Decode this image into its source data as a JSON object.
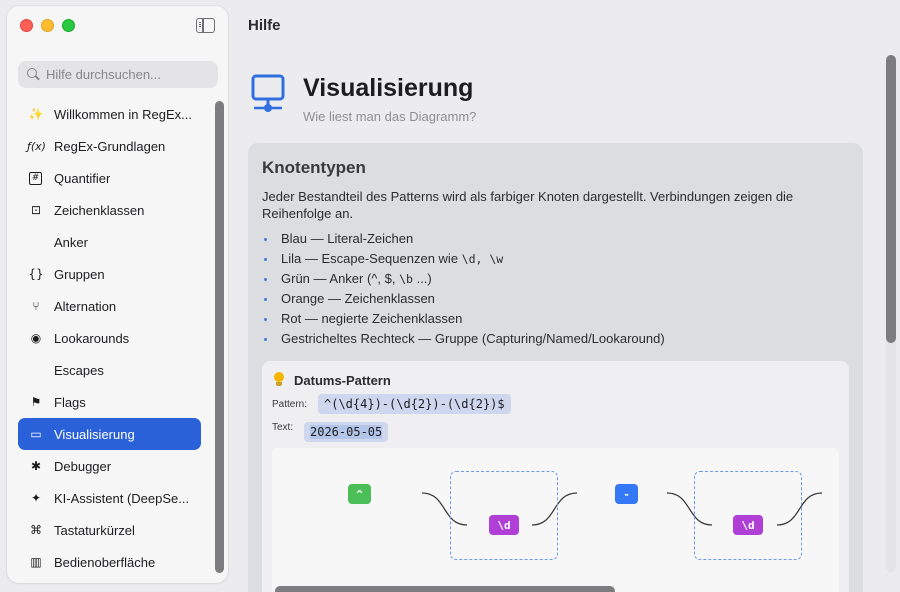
{
  "app": {
    "title": "Hilfe"
  },
  "sidebar": {
    "search_placeholder": "Hilfe durchsuchen...",
    "items": [
      {
        "label": "Willkommen in RegEx...",
        "icon": "wand-icon",
        "glyph": "✨"
      },
      {
        "label": "RegEx-Grundlagen",
        "icon": "function-icon",
        "glyph": "ƒ(x)"
      },
      {
        "label": "Quantifier",
        "icon": "hash-box-icon",
        "glyph": "#"
      },
      {
        "label": "Zeichenklassen",
        "icon": "class-box-icon",
        "glyph": "⊡"
      },
      {
        "label": "Anker",
        "icon": "",
        "glyph": ""
      },
      {
        "label": "Gruppen",
        "icon": "braces-icon",
        "glyph": "{}"
      },
      {
        "label": "Alternation",
        "icon": "fork-icon",
        "glyph": "⑂"
      },
      {
        "label": "Lookarounds",
        "icon": "eye-icon",
        "glyph": "◉"
      },
      {
        "label": "Escapes",
        "icon": "",
        "glyph": ""
      },
      {
        "label": "Flags",
        "icon": "flag-icon",
        "glyph": "⚑"
      },
      {
        "label": "Visualisierung",
        "icon": "monitor-icon",
        "glyph": "▭",
        "active": true
      },
      {
        "label": "Debugger",
        "icon": "bug-icon",
        "glyph": "✱"
      },
      {
        "label": "KI-Assistent (DeepSe...",
        "icon": "sparkle-icon",
        "glyph": "✦"
      },
      {
        "label": "Tastaturkürzel",
        "icon": "command-icon",
        "glyph": "⌘"
      },
      {
        "label": "Bedienoberfläche",
        "icon": "columns-icon",
        "glyph": "▥"
      }
    ]
  },
  "page": {
    "title": "Visualisierung",
    "subtitle": "Wie liest man das Diagramm?",
    "icon": "network-monitor-icon"
  },
  "section": {
    "title": "Knotentypen",
    "intro": "Jeder Bestandteil des Patterns wird als farbiger Knoten dargestellt. Verbindungen zeigen die Reihenfolge an.",
    "bullets": [
      {
        "pre": "Blau — Literal-Zeichen",
        "code": "",
        "post": ""
      },
      {
        "pre": "Lila — Escape-Sequenzen wie ",
        "code": "\\d, \\w",
        "post": ""
      },
      {
        "pre": "Grün — Anker (^, $, ",
        "code": "\\b",
        "post": " ...)"
      },
      {
        "pre": "Orange — Zeichenklassen",
        "code": "",
        "post": ""
      },
      {
        "pre": "Rot — negierte Zeichenklassen",
        "code": "",
        "post": ""
      },
      {
        "pre": "Gestricheltes Rechteck — Gruppe (Capturing/Named/Lookaround)",
        "code": "",
        "post": ""
      }
    ]
  },
  "example": {
    "title": "Datums-Pattern",
    "pattern_label": "Pattern:",
    "pattern": "^(\\d{4})-(\\d{2})-(\\d{2})$",
    "text_label": "Text:",
    "text": "2026-05-05",
    "nodes": {
      "anchor": "^",
      "literal": "-",
      "escape1": "\\d",
      "escape2": "\\d"
    }
  },
  "colors": {
    "accent": "#2b61d8",
    "anchor": "#4cbe57",
    "literal": "#3478f6",
    "escape": "#b03fd6",
    "group_border": "#6b9be8"
  }
}
